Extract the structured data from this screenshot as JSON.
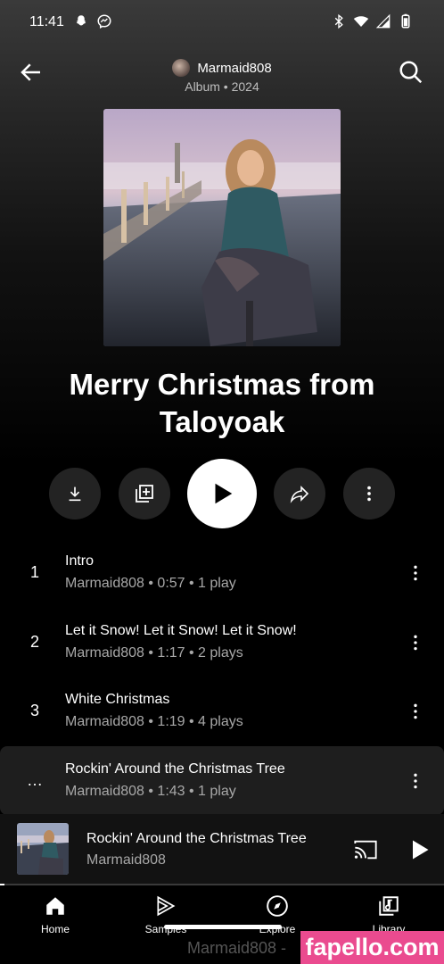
{
  "status": {
    "time": "11:41",
    "left_icons": [
      "snapchat-icon",
      "messenger-icon"
    ],
    "right_icons": [
      "bluetooth-icon",
      "wifi-icon",
      "signal-icon",
      "battery-icon"
    ]
  },
  "header": {
    "artist": "Marmaid808",
    "meta": "Album • 2024"
  },
  "album": {
    "title_line1": "Merry Christmas from",
    "title_line2": "Taloyoak"
  },
  "actions": [
    "download-icon",
    "add-to-playlist-icon",
    "play-icon",
    "share-icon",
    "more-icon"
  ],
  "tracks": [
    {
      "num": "1",
      "title": "Intro",
      "sub": "Marmaid808 • 0:57 • 1 play"
    },
    {
      "num": "2",
      "title": "Let it Snow! Let it Snow! Let it Snow!",
      "sub": "Marmaid808 • 1:17 • 2 plays"
    },
    {
      "num": "3",
      "title": "White Christmas",
      "sub": "Marmaid808 • 1:19 • 4 plays"
    },
    {
      "num": "…",
      "title": "Rockin' Around the Christmas Tree",
      "sub": "Marmaid808 • 1:43 • 1 play"
    }
  ],
  "mini_player": {
    "title": "Rockin' Around the Christmas Tree",
    "artist": "Marmaid808",
    "progress": 0.01
  },
  "nav": {
    "items": [
      {
        "label": "Home",
        "icon": "home-icon"
      },
      {
        "label": "Samples",
        "icon": "samples-icon"
      },
      {
        "label": "Explore",
        "icon": "explore-icon"
      },
      {
        "label": "Library",
        "icon": "library-icon"
      }
    ],
    "ghost": "Marmaid808 -"
  },
  "watermark": "fapello.com",
  "colors": {
    "background": "#000000",
    "surface": "#232323",
    "active_row": "#1e1e1e",
    "watermark": "#ea4b8f"
  }
}
